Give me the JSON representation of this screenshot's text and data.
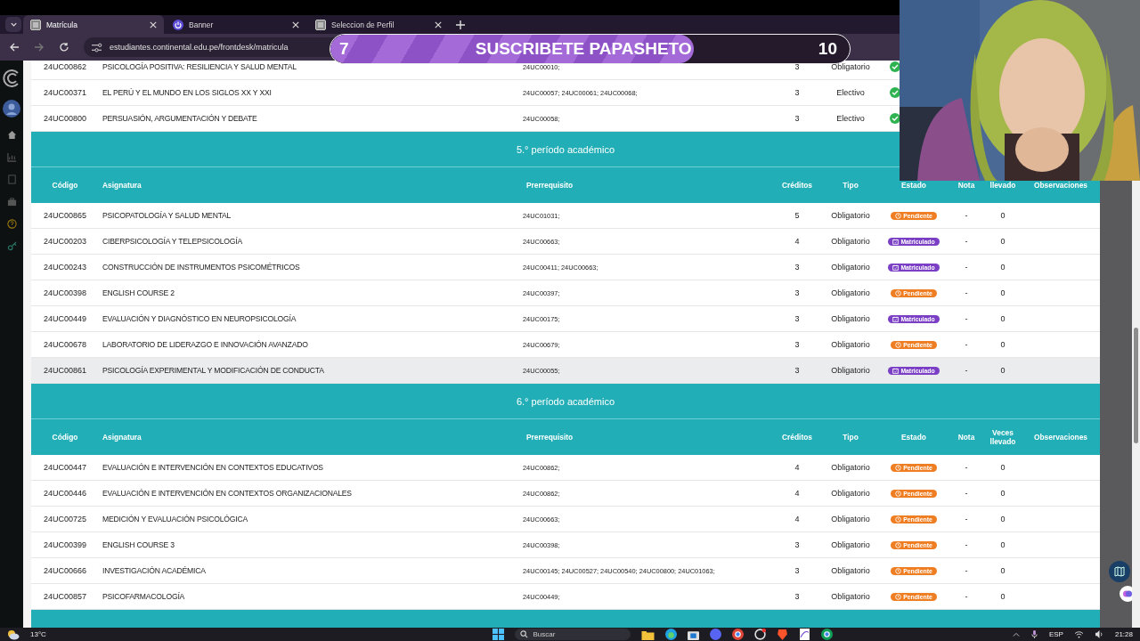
{
  "browser": {
    "tabs": [
      {
        "title": "Matrícula",
        "selected": true,
        "kind": "page"
      },
      {
        "title": "Banner",
        "selected": false,
        "kind": "power"
      },
      {
        "title": "Seleccion de Perfil",
        "selected": false,
        "kind": "page"
      }
    ],
    "url": "estudiantes.continental.edu.pe/frontdesk/matricula"
  },
  "goal_overlay": {
    "start": "7",
    "title": "SUSCRIBETE PAPASHETO",
    "end": "10",
    "level": 0.7
  },
  "top_rows": [
    {
      "code": "24UC00862",
      "name": "PSICOLOGÍA POSITIVA: RESILIENCIA Y SALUD MENTAL",
      "prereq": "24UC00010;",
      "credits": "3",
      "type": "Obligatorio",
      "status": {
        "kind": "aprobado"
      }
    },
    {
      "code": "24UC00371",
      "name": "EL PERÚ Y EL MUNDO EN LOS SIGLOS XX Y XXI",
      "prereq": "24UC00057; 24UC00061; 24UC00068;",
      "credits": "3",
      "type": "Electivo",
      "status": {
        "kind": "aprobado"
      }
    },
    {
      "code": "24UC00800",
      "name": "PERSUASIÓN, ARGUMENTACIÓN Y DEBATE",
      "prereq": "24UC00058;",
      "credits": "3",
      "type": "Electivo",
      "status": {
        "kind": "aprobado"
      }
    }
  ],
  "sections": [
    {
      "title": "5.° período académico",
      "columns": [
        "Código",
        "Asignatura",
        "Prerrequisito",
        "Créditos",
        "Tipo",
        "Estado",
        "Nota",
        "llevado",
        "Observaciones"
      ],
      "rows": [
        {
          "code": "24UC00865",
          "name": "PSICOPATOLOGÍA Y SALUD MENTAL",
          "prereq": "24UC01031;",
          "credits": "5",
          "type": "Obligatorio",
          "status": {
            "kind": "pendiente",
            "label": "Pendiente"
          },
          "nota": "-",
          "veces": "0",
          "highlighted": false
        },
        {
          "code": "24UC00203",
          "name": "CIBERPSICOLOGÍA Y TELEPSICOLOGÍA",
          "prereq": "24UC00663;",
          "credits": "4",
          "type": "Obligatorio",
          "status": {
            "kind": "matriculado",
            "label": "Matriculado"
          },
          "nota": "-",
          "veces": "0",
          "highlighted": false
        },
        {
          "code": "24UC00243",
          "name": "CONSTRUCCIÓN DE INSTRUMENTOS PSICOMÉTRICOS",
          "prereq": "24UC00411; 24UC00663;",
          "credits": "3",
          "type": "Obligatorio",
          "status": {
            "kind": "matriculado",
            "label": "Matriculado"
          },
          "nota": "-",
          "veces": "0",
          "highlighted": false
        },
        {
          "code": "24UC00398",
          "name": "ENGLISH COURSE 2",
          "prereq": "24UC00397;",
          "credits": "3",
          "type": "Obligatorio",
          "status": {
            "kind": "pendiente",
            "label": "Pendiente"
          },
          "nota": "-",
          "veces": "0",
          "highlighted": false
        },
        {
          "code": "24UC00449",
          "name": "EVALUACIÓN Y DIAGNÓSTICO EN NEUROPSICOLOGÍA",
          "prereq": "24UC00175;",
          "credits": "3",
          "type": "Obligatorio",
          "status": {
            "kind": "matriculado",
            "label": "Matriculado"
          },
          "nota": "-",
          "veces": "0",
          "highlighted": false
        },
        {
          "code": "24UC00678",
          "name": "LABORATORIO DE LIDERAZGO E INNOVACIÓN AVANZADO",
          "prereq": "24UC00679;",
          "credits": "3",
          "type": "Obligatorio",
          "status": {
            "kind": "pendiente",
            "label": "Pendiente"
          },
          "nota": "-",
          "veces": "0",
          "highlighted": false
        },
        {
          "code": "24UC00861",
          "name": "PSICOLOGÍA EXPERIMENTAL Y MODIFICACIÓN DE CONDUCTA",
          "prereq": "24UC00055;",
          "credits": "3",
          "type": "Obligatorio",
          "status": {
            "kind": "matriculado",
            "label": "Matriculado"
          },
          "nota": "-",
          "veces": "0",
          "highlighted": true
        }
      ]
    },
    {
      "title": "6.° período académico",
      "columns": [
        "Código",
        "Asignatura",
        "Prerrequisito",
        "Créditos",
        "Tipo",
        "Estado",
        "Nota",
        "Veces llevado",
        "Observaciones"
      ],
      "rows": [
        {
          "code": "24UC00447",
          "name": "EVALUACIÓN E INTERVENCIÓN EN CONTEXTOS EDUCATIVOS",
          "prereq": "24UC00862;",
          "credits": "4",
          "type": "Obligatorio",
          "status": {
            "kind": "pendiente",
            "label": "Pendiente"
          },
          "nota": "-",
          "veces": "0",
          "highlighted": false
        },
        {
          "code": "24UC00446",
          "name": "EVALUACIÓN E INTERVENCIÓN EN CONTEXTOS ORGANIZACIONALES",
          "prereq": "24UC00862;",
          "credits": "4",
          "type": "Obligatorio",
          "status": {
            "kind": "pendiente",
            "label": "Pendiente"
          },
          "nota": "-",
          "veces": "0",
          "highlighted": false
        },
        {
          "code": "24UC00725",
          "name": "MEDICIÓN Y EVALUACIÓN PSICOLÓGICA",
          "prereq": "24UC00663;",
          "credits": "4",
          "type": "Obligatorio",
          "status": {
            "kind": "pendiente",
            "label": "Pendiente"
          },
          "nota": "-",
          "veces": "0",
          "highlighted": false
        },
        {
          "code": "24UC00399",
          "name": "ENGLISH COURSE 3",
          "prereq": "24UC00398;",
          "credits": "3",
          "type": "Obligatorio",
          "status": {
            "kind": "pendiente",
            "label": "Pendiente"
          },
          "nota": "-",
          "veces": "0",
          "highlighted": false
        },
        {
          "code": "24UC00666",
          "name": "INVESTIGACIÓN ACADÉMICA",
          "prereq": "24UC00145; 24UC00527; 24UC00540; 24UC00800; 24UC01063;",
          "credits": "3",
          "type": "Obligatorio",
          "status": {
            "kind": "pendiente",
            "label": "Pendiente"
          },
          "nota": "-",
          "veces": "0",
          "highlighted": false
        },
        {
          "code": "24UC00857",
          "name": "PSICOFARMACOLOGÍA",
          "prereq": "24UC00449;",
          "credits": "3",
          "type": "Obligatorio",
          "status": {
            "kind": "pendiente",
            "label": "Pendiente"
          },
          "nota": "-",
          "veces": "0",
          "highlighted": false
        }
      ]
    }
  ],
  "taskbar": {
    "weather": "13°C",
    "search_placeholder": "Buscar",
    "language": "ESP",
    "time": "21:28"
  }
}
